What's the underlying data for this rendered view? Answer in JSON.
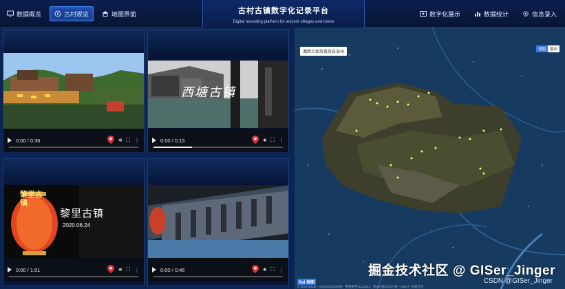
{
  "header": {
    "title": "古村古镇数字化记录平台",
    "subtitle": "Digital recording platform for ancient villages and towns",
    "nav_left": [
      {
        "label": "数据概览",
        "icon": "monitor-icon",
        "active": false
      },
      {
        "label": "古村观览",
        "icon": "compass-icon",
        "active": true
      },
      {
        "label": "地图界面",
        "icon": "building-icon",
        "active": false
      }
    ],
    "nav_right": [
      {
        "label": "数字化展示",
        "icon": "display-icon"
      },
      {
        "label": "数据统计",
        "icon": "bar-chart-icon"
      },
      {
        "label": "信息录入",
        "icon": "gear-icon"
      }
    ]
  },
  "videos": [
    {
      "time": "0:00 / 0:36",
      "progress": 0.0
    },
    {
      "time": "0:00 / 0:13",
      "progress": 0.3,
      "overlay_text": "西塘古镇"
    },
    {
      "time": "0:00 / 1:01",
      "progress": 0.0,
      "overlay_text": "黎里古镇",
      "overlay_date": "2020.06.24",
      "lantern_text": "黎里古镇"
    },
    {
      "time": "0:00 / 0:46",
      "progress": 0.0
    }
  ],
  "map": {
    "region_label": "湘西土家族苗族自治州",
    "toggle": [
      "地图",
      "混合"
    ],
    "watermark": "掘金技术社区 @ GISer_Jinger",
    "watermark2": "CSDN @GISer_Jinger",
    "baidu_logo": "Bai 地图",
    "copyright": "© 2024 Baidu - GS(2023)3206号 - 甲测资字11111342 - 京ICP证030173号 - Data © 长地万方"
  },
  "colors": {
    "header_bg": "#0b1f4f",
    "active_nav": "#1d4aa8",
    "map_pin": "#e2323c"
  }
}
